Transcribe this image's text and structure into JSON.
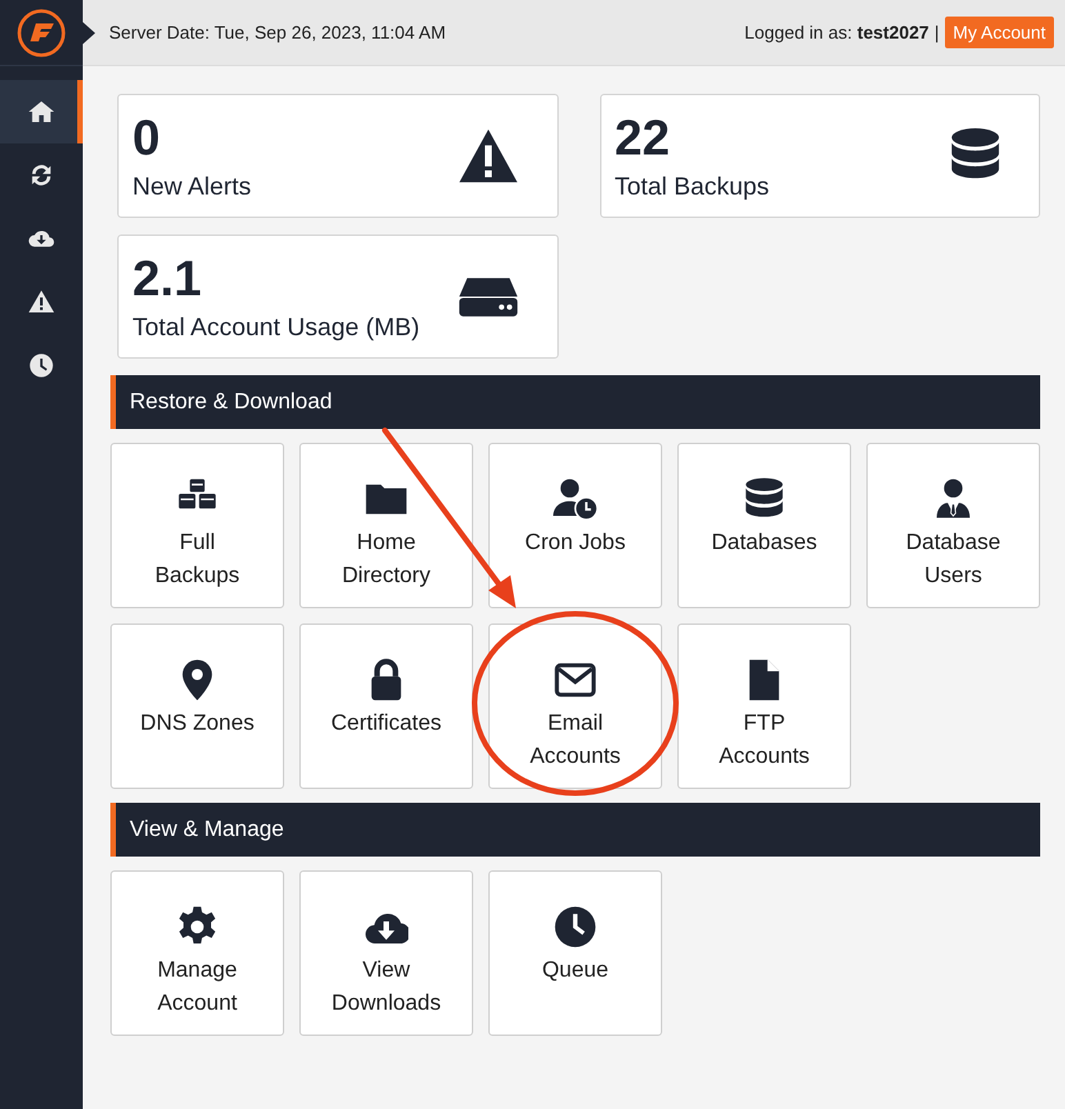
{
  "topbar": {
    "server_date": "Server Date: Tue, Sep 26, 2023, 11:04 AM",
    "login_label": "Logged in as:",
    "username": "test2027",
    "separator": "|",
    "account_button": "My Account"
  },
  "sidebar": {
    "items": [
      {
        "selected": true
      },
      {
        "selected": false
      },
      {
        "selected": false
      },
      {
        "selected": false
      },
      {
        "selected": false
      }
    ]
  },
  "stats": [
    {
      "value": "0",
      "label": "New Alerts"
    },
    {
      "value": "22",
      "label": "Total Backups"
    },
    {
      "value": "2.1",
      "label": "Total Account Usage (MB)"
    }
  ],
  "sections": [
    {
      "title": "Restore & Download",
      "tiles": [
        {
          "label": "Full Backups"
        },
        {
          "label": "Home Directory"
        },
        {
          "label": "Cron Jobs"
        },
        {
          "label": "Databases"
        },
        {
          "label": "Database Users"
        },
        {
          "label": "DNS Zones"
        },
        {
          "label": "Certificates"
        },
        {
          "label": "Email Accounts"
        },
        {
          "label": "FTP Accounts"
        }
      ]
    },
    {
      "title": "View & Manage",
      "tiles": [
        {
          "label": "Manage Account"
        },
        {
          "label": "View Downloads"
        },
        {
          "label": "Queue"
        }
      ]
    }
  ]
}
